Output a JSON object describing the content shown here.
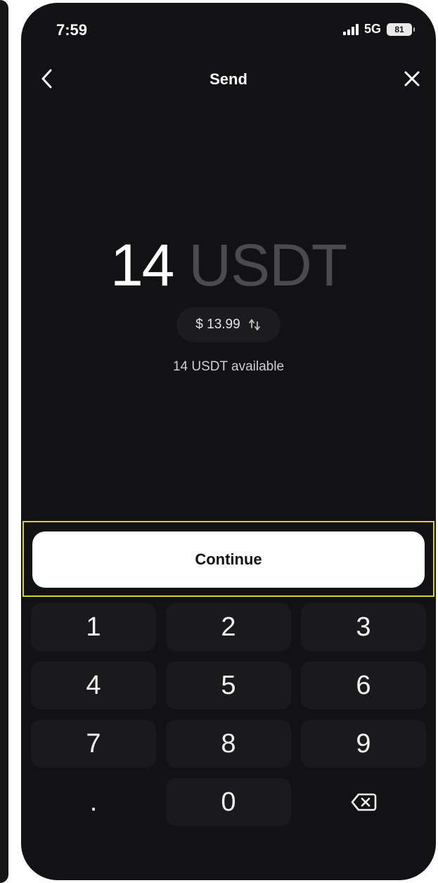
{
  "status_bar": {
    "time": "7:59",
    "network": "5G",
    "battery": "81"
  },
  "nav": {
    "title": "Send"
  },
  "amount": {
    "value": "14",
    "unit": "USDT",
    "fiat": "$ 13.99",
    "available": "14 USDT available"
  },
  "continue_label": "Continue",
  "keypad": {
    "keys": [
      "1",
      "2",
      "3",
      "4",
      "5",
      "6",
      "7",
      "8",
      "9",
      ".",
      "0"
    ]
  },
  "colors": {
    "background": "#121214",
    "key_background": "#1a1a1d",
    "unit_text": "#4b4b4f",
    "highlight_border": "#d7d22e"
  },
  "icons": {
    "back": "chevron-left-icon",
    "close": "close-icon",
    "swap": "swap-arrows-icon",
    "backspace": "backspace-icon",
    "signal": "signal-icon",
    "battery": "battery-icon"
  }
}
